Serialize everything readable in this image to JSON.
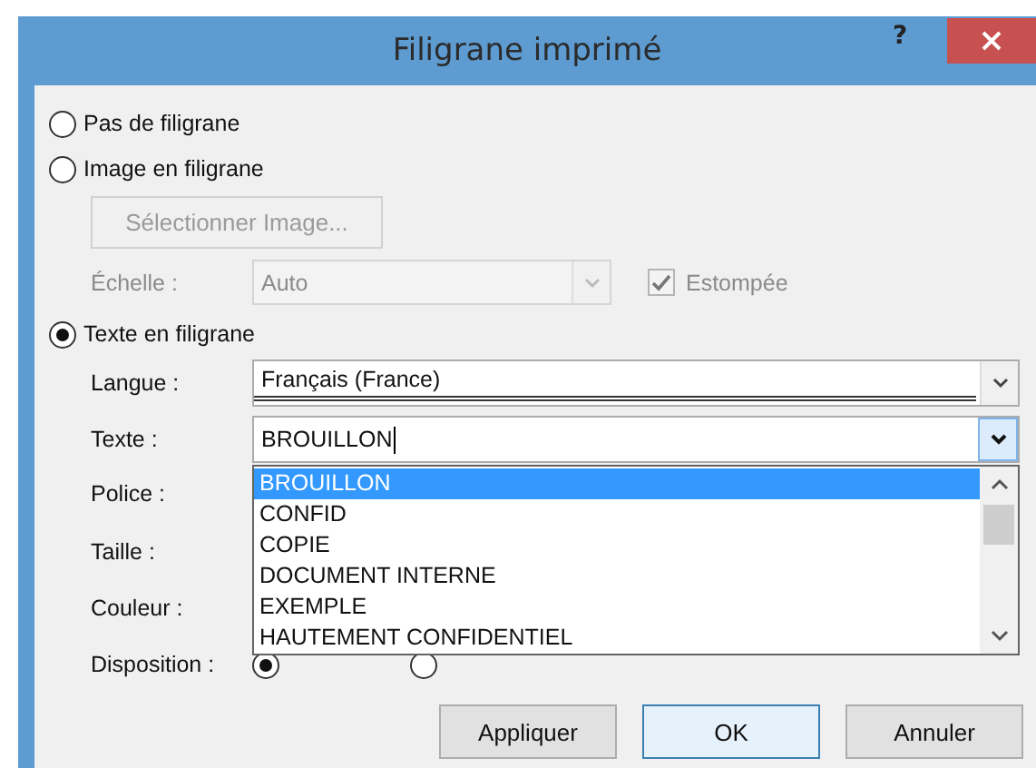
{
  "window": {
    "title": "Filigrane imprimé",
    "help": "?"
  },
  "no_watermark": {
    "label": "Pas de filigrane",
    "selected": false
  },
  "picture_watermark": {
    "label": "Image en filigrane",
    "selected": false,
    "select_button": {
      "label": "Sélectionner Image...",
      "disabled": true
    },
    "scale": {
      "label": "Échelle :",
      "value": "Auto",
      "disabled": true
    },
    "washout": {
      "label": "Estompée",
      "checked": true,
      "disabled": true
    }
  },
  "text_watermark": {
    "label": "Texte en filigrane",
    "selected": true,
    "language": {
      "label": "Langue :",
      "value": "Français (France)"
    },
    "text": {
      "label": "Texte :",
      "value": "BROUILLON",
      "dropdown": {
        "items": [
          {
            "label": "BROUILLON",
            "selected": true
          },
          {
            "label": "CONFID",
            "selected": false
          },
          {
            "label": "COPIE",
            "selected": false
          },
          {
            "label": "DOCUMENT INTERNE",
            "selected": false
          },
          {
            "label": "EXEMPLE",
            "selected": false
          },
          {
            "label": "HAUTEMENT CONFIDENTIEL",
            "selected": false
          }
        ]
      }
    },
    "font": {
      "label": "Police :"
    },
    "size": {
      "label": "Taille :"
    },
    "color": {
      "label": "Couleur :"
    },
    "layout": {
      "label": "Disposition :",
      "options": [
        {
          "selected": true
        },
        {
          "selected": false
        }
      ]
    }
  },
  "buttons": [
    {
      "label": "Appliquer",
      "default": false
    },
    {
      "label": "OK",
      "default": true
    },
    {
      "label": "Annuler",
      "default": false
    }
  ]
}
